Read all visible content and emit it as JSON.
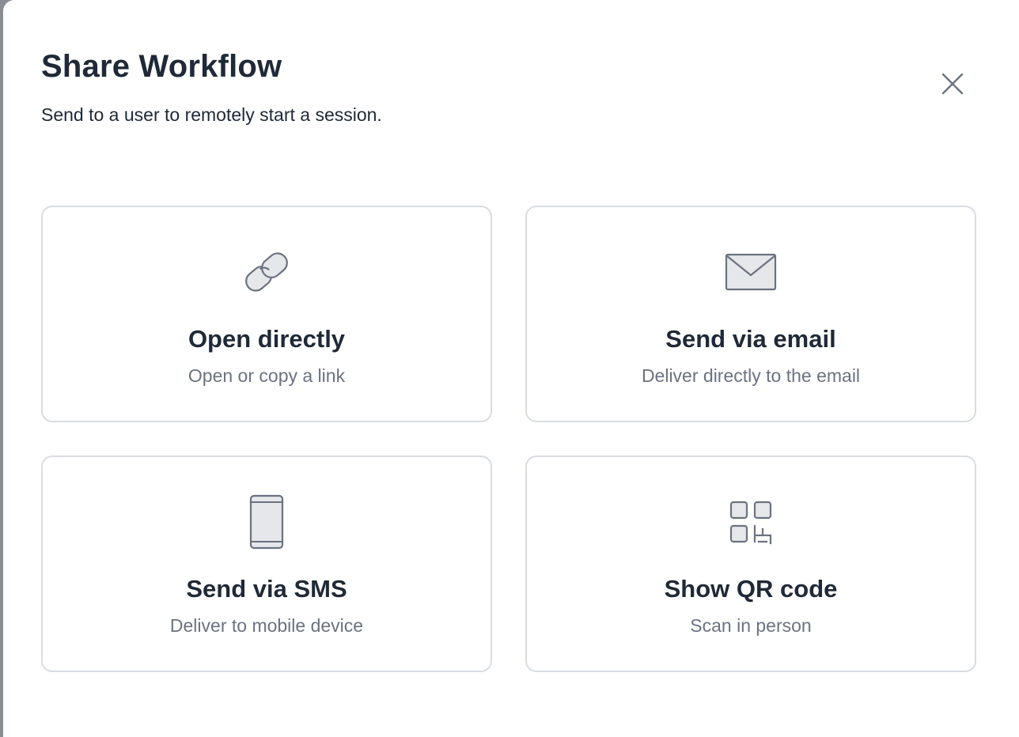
{
  "modal": {
    "title": "Share Workflow",
    "subtitle": "Send to a user to remotely start a session.",
    "close_icon": "close-icon"
  },
  "options": [
    {
      "title": "Open directly",
      "description": "Open or copy a link",
      "icon": "link-icon"
    },
    {
      "title": "Send via email",
      "description": "Deliver directly to the email",
      "icon": "envelope-icon"
    },
    {
      "title": "Send via SMS",
      "description": "Deliver to mobile device",
      "icon": "phone-icon"
    },
    {
      "title": "Show QR code",
      "description": "Scan in person",
      "icon": "qr-code-icon"
    }
  ],
  "colors": {
    "text_primary": "#1f2937",
    "text_secondary": "#6b7280",
    "border": "#d9dce1",
    "icon_stroke": "#6b7280",
    "icon_fill": "#e5e7eb"
  }
}
